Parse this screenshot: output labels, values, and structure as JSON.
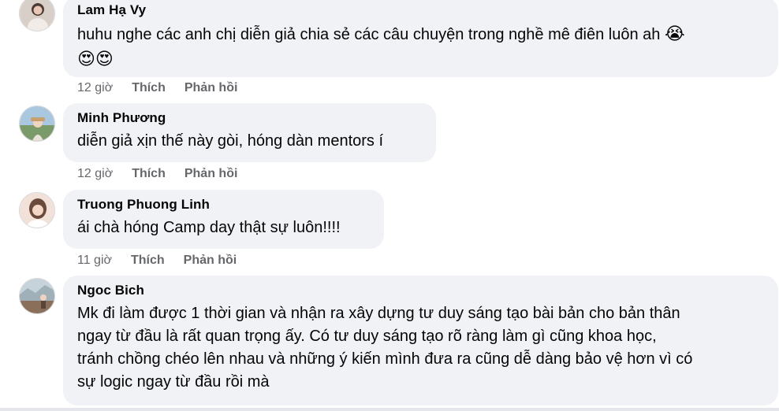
{
  "comments": [
    {
      "author": "Lam Hạ Vy",
      "text": "huhu nghe các anh chị diễn giả chia sẻ các câu chuyện trong nghề mê điên luôn ah",
      "emoji_inline": "😭",
      "emoji_line": "😍😍",
      "time": "12 giờ",
      "like": "Thích",
      "reply": "Phản hồi",
      "avatar_color": "#c9b8b0"
    },
    {
      "author": "Minh Phương",
      "text": "diễn giả xịn thế này gòi, hóng dàn mentors í",
      "time": "12 giờ",
      "like": "Thích",
      "reply": "Phản hồi",
      "avatar_color": "#8fb2c9"
    },
    {
      "author": "Truong Phuong Linh",
      "text": "ái chà hóng Camp day thật sự luôn!!!!",
      "time": "11 giờ",
      "like": "Thích",
      "reply": "Phản hồi",
      "avatar_color": "#e6c7b7"
    },
    {
      "author": "Ngoc Bich",
      "lines": [
        "Mk đi làm được 1 thời gian và nhận ra xây dựng tư duy sáng tạo bài bản cho bản thân",
        "ngay từ đầu là rất quan trọng ấy. Có tư duy sáng tạo rõ ràng làm gì cũng khoa học,",
        "tránh chồng chéo lên nhau và những ý kiến mình đưa ra cũng dễ dàng bảo vệ hơn vì có",
        "sự logic ngay từ đầu rồi mà"
      ],
      "avatar_color": "#b7c4cc"
    }
  ]
}
